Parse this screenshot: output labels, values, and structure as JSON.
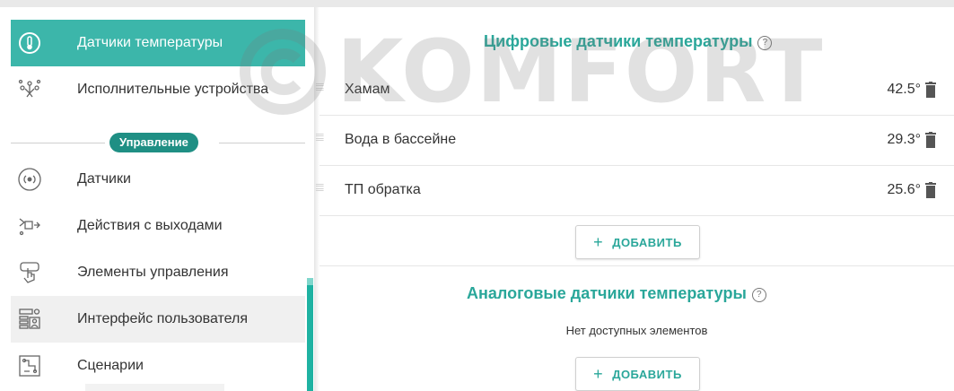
{
  "sidebar": {
    "items": [
      {
        "label": "Датчики температуры",
        "icon": "thermometer-icon"
      },
      {
        "label": "Исполнительные устройства",
        "icon": "actuators-icon"
      },
      {
        "label": "Датчики",
        "icon": "sensor-signal-icon"
      },
      {
        "label": "Действия с выходами",
        "icon": "output-actions-icon"
      },
      {
        "label": "Элементы управления",
        "icon": "touch-hand-icon"
      },
      {
        "label": "Интерфейс пользователя",
        "icon": "user-interface-icon"
      },
      {
        "label": "Сценарии",
        "icon": "scenario-icon"
      }
    ],
    "section_label": "Управление"
  },
  "main": {
    "digital": {
      "title": "Цифровые датчики температуры",
      "help": "?",
      "rows": [
        {
          "name": "Хамам",
          "value": "42.5°"
        },
        {
          "name": "Вода в бассейне",
          "value": "29.3°"
        },
        {
          "name": "ТП обратка",
          "value": "25.6°"
        }
      ],
      "add_label": "ДОБАВИТЬ",
      "add_plus": "+"
    },
    "analog": {
      "title": "Аналоговые датчики температуры",
      "help": "?",
      "empty_text": "Нет доступных элементов",
      "add_label": "ДОБАВИТЬ",
      "add_plus": "+"
    }
  },
  "watermark": {
    "text": "KOMFORT"
  },
  "colors": {
    "accent": "#3cb6aa",
    "badge": "#1f8f84",
    "title": "#2aa79a"
  }
}
